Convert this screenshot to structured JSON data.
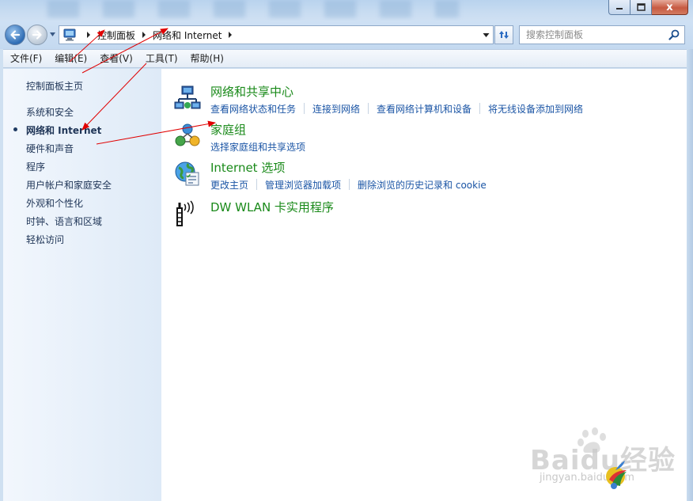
{
  "window": {
    "close_label": "x"
  },
  "address": {
    "crumbs": [
      "控制面板",
      "网络和 Internet"
    ]
  },
  "search": {
    "placeholder": "搜索控制面板"
  },
  "menu": [
    "文件(F)",
    "编辑(E)",
    "查看(V)",
    "工具(T)",
    "帮助(H)"
  ],
  "sidebar": {
    "items": [
      {
        "label": "控制面板主页",
        "active": false
      },
      {
        "label": "系统和安全",
        "active": false
      },
      {
        "label": "网络和 Internet",
        "active": true
      },
      {
        "label": "硬件和声音",
        "active": false
      },
      {
        "label": "程序",
        "active": false
      },
      {
        "label": "用户帐户和家庭安全",
        "active": false
      },
      {
        "label": "外观和个性化",
        "active": false
      },
      {
        "label": "时钟、语言和区域",
        "active": false
      },
      {
        "label": "轻松访问",
        "active": false
      }
    ]
  },
  "categories": [
    {
      "title": "网络和共享中心",
      "icon": "network-sharing-icon",
      "links": [
        "查看网络状态和任务",
        "连接到网络",
        "查看网络计算机和设备",
        "将无线设备添加到网络"
      ]
    },
    {
      "title": "家庭组",
      "icon": "homegroup-icon",
      "links": [
        "选择家庭组和共享选项"
      ]
    },
    {
      "title": "Internet 选项",
      "icon": "internet-options-icon",
      "links": [
        "更改主页",
        "管理浏览器加载项",
        "删除浏览的历史记录和 cookie"
      ]
    },
    {
      "title": "DW WLAN 卡实用程序",
      "icon": "wlan-antenna-icon",
      "links": []
    }
  ],
  "watermark": {
    "logo": "Baidu经验",
    "url": "jingyan.baidu.com"
  },
  "colors": {
    "category_title": "#1a8a1a",
    "link": "#1b55a5",
    "annotation_arrow": "#e00000"
  }
}
